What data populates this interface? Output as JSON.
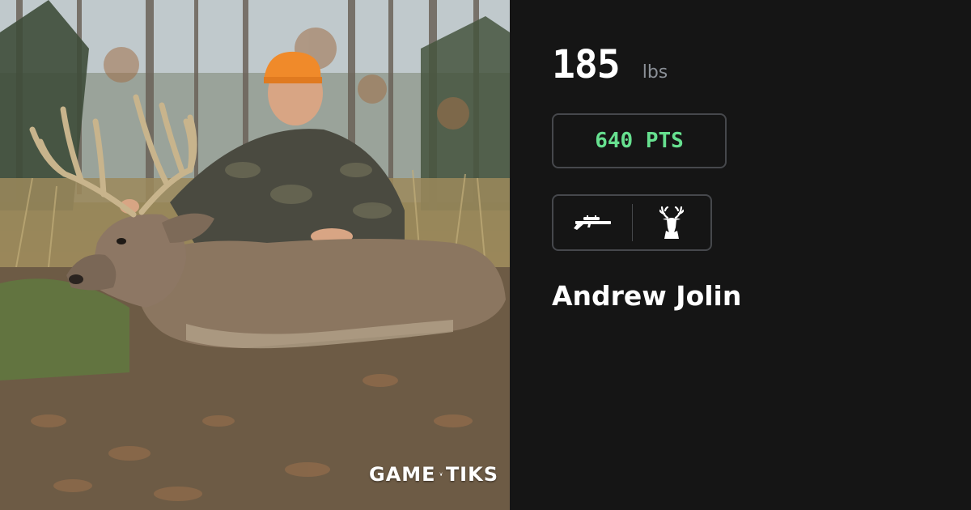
{
  "harvest": {
    "weight_value": "185",
    "weight_unit": "lbs",
    "points_label": "640 PTS",
    "weapon_icon": "rifle-icon",
    "species_icon": "deer-head-icon",
    "hunter_name": "Andrew Jolin"
  },
  "brand": {
    "logo_left": "GAME",
    "logo_right": "TIKS"
  },
  "colors": {
    "background": "#151515",
    "points_green": "#66e08f",
    "border_gray": "#46484c",
    "unit_gray": "#8a8f96"
  }
}
